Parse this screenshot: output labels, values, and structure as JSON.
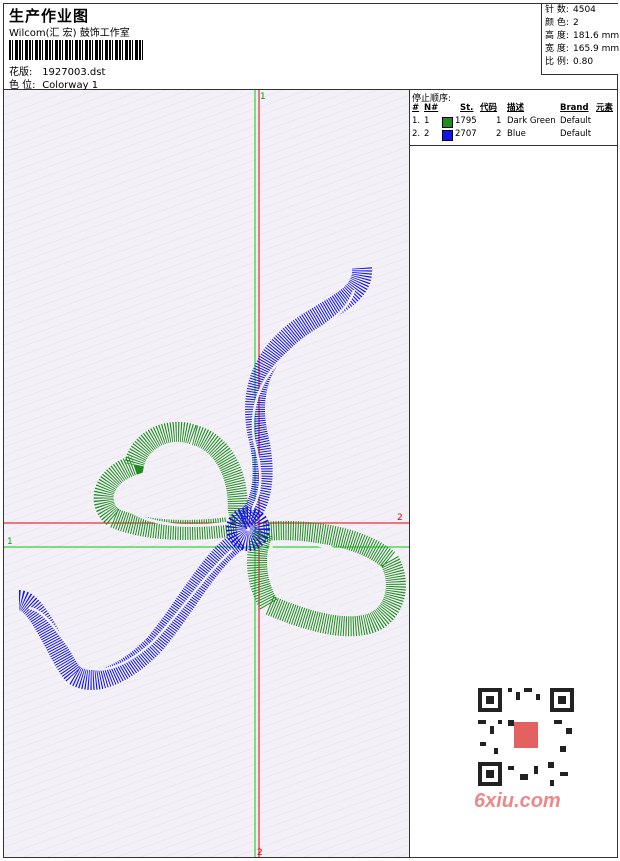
{
  "header": {
    "title": "生产作业图",
    "company": "Wilcom(汇 宏) 鼓饰工作室",
    "pattern_label": "花版:",
    "pattern_value": "1927003.dst",
    "colorway_label": "色 位:",
    "colorway_value": "Colorway 1"
  },
  "stats": [
    {
      "label": "针 数:",
      "value": "4504"
    },
    {
      "label": "颜 色:",
      "value": "2"
    },
    {
      "label": "高 度:",
      "value": "181.6 mm"
    },
    {
      "label": "宽 度:",
      "value": "165.9 mm"
    },
    {
      "label": "比 例:",
      "value": "0.80"
    }
  ],
  "stop_sequence": {
    "title": "停止顺序:",
    "columns": [
      "#",
      "N#",
      "St.",
      "代码",
      "描述",
      "Brand",
      "元素"
    ],
    "rows": [
      {
        "num": "1.",
        "n": "1",
        "color": "#1e8c1e",
        "stitches": "1795",
        "code": "1",
        "desc": "Dark Green",
        "brand": "Default"
      },
      {
        "num": "2.",
        "n": "2",
        "color": "#1414e6",
        "stitches": "2707",
        "code": "2",
        "desc": "Blue",
        "brand": "Default"
      }
    ]
  },
  "axes": {
    "v1_top": "1",
    "v2_bottom": "2",
    "h1_left": "1",
    "h2_right": "2",
    "green": "#00d000",
    "red": "#e00000"
  },
  "watermark": {
    "text": "6xiu.com"
  }
}
